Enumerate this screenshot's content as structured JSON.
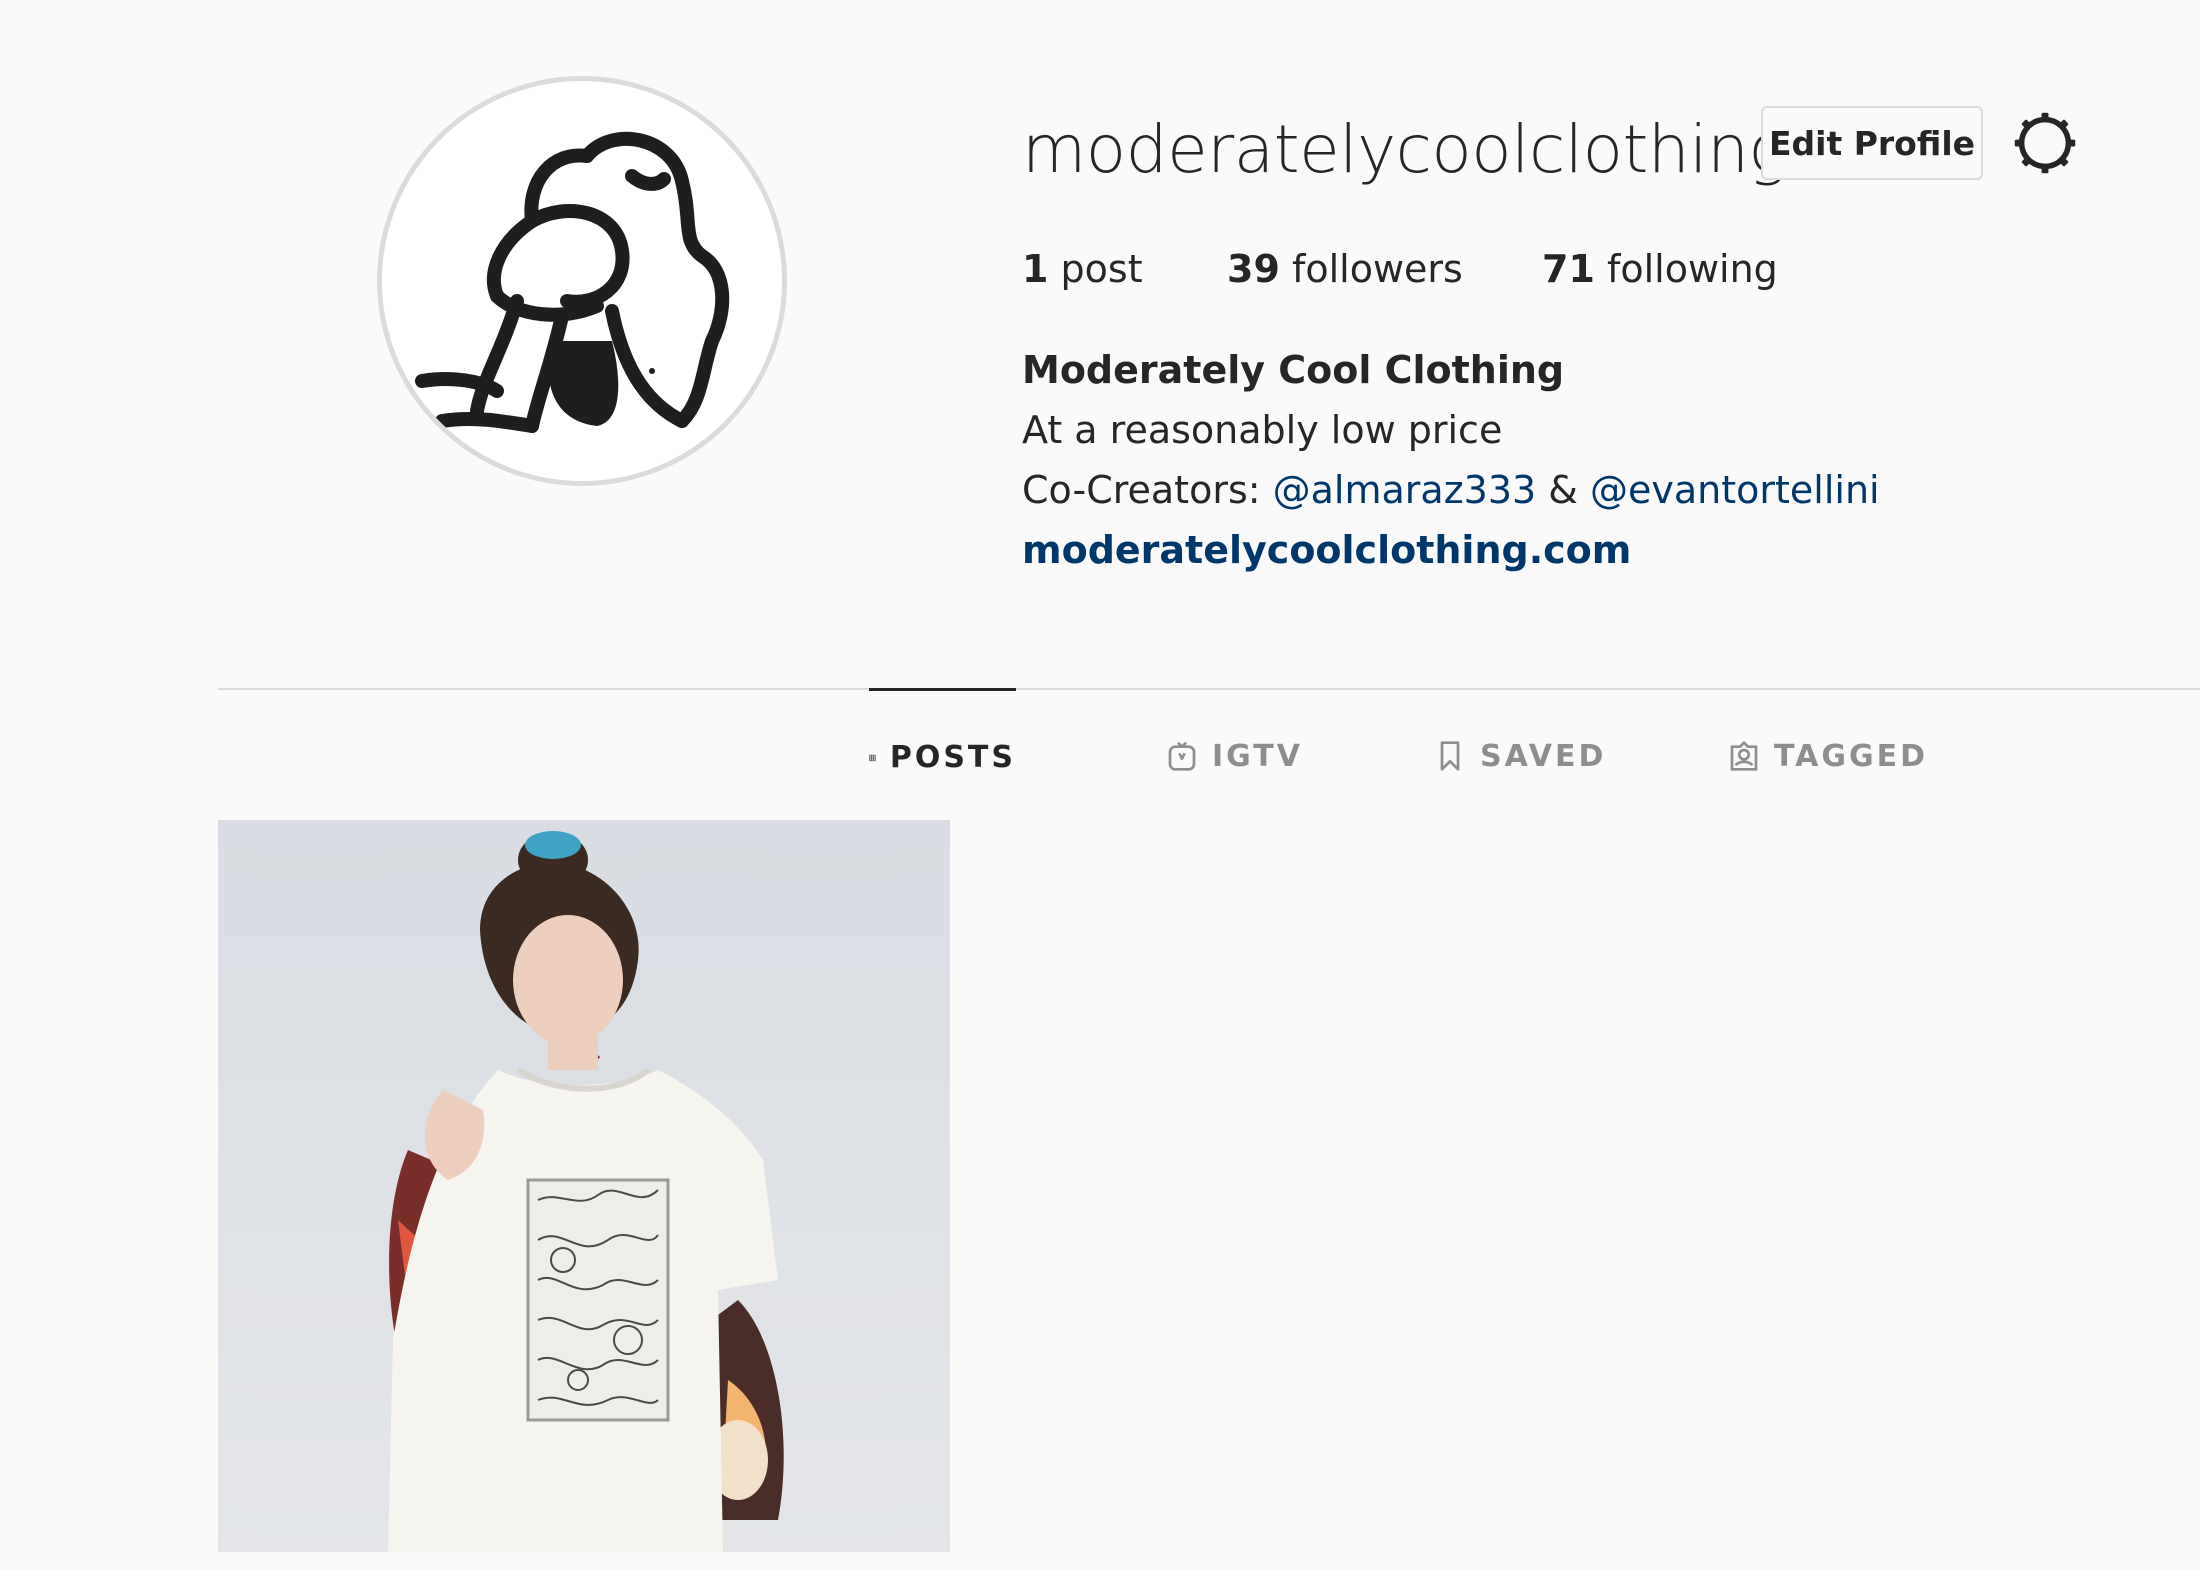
{
  "profile": {
    "username": "moderatelycoolclothing",
    "edit_profile_label": "Edit Profile",
    "stats": {
      "posts_count": "1",
      "posts_label": " post",
      "followers_count": "39",
      "followers_label": " followers",
      "following_count": "71",
      "following_label": " following"
    },
    "bio": {
      "full_name": "Moderately Cool Clothing",
      "tagline": "At a reasonably low price",
      "cocreators_prefix": "Co-Creators: ",
      "mention_1": "@almaraz333",
      "separator": " & ",
      "mention_2": "@evantortellini",
      "website": "moderatelycoolclothing.com"
    }
  },
  "tabs": [
    {
      "label": "POSTS",
      "icon": "grid-icon",
      "active": true
    },
    {
      "label": "IGTV",
      "icon": "igtv-icon",
      "active": false
    },
    {
      "label": "SAVED",
      "icon": "bookmark-icon",
      "active": false
    },
    {
      "label": "TAGGED",
      "icon": "tagged-person-icon",
      "active": false
    }
  ],
  "icons": {
    "settings": "gear-icon",
    "avatar": "hugging-knees-figure-drawing"
  },
  "colors": {
    "background": "#fafafa",
    "text": "#262626",
    "link": "#00376b",
    "muted": "#8e8e8e",
    "border": "#dbdbdb"
  }
}
